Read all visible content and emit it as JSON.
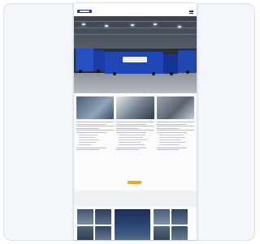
{
  "topbar": {
    "phone": "",
    "email": ""
  },
  "header": {
    "logo_text": ""
  },
  "hero": {
    "caption": ""
  },
  "columns": [
    {
      "heading": ""
    },
    {
      "heading": ""
    },
    {
      "heading": ""
    }
  ],
  "cta": {
    "label": ""
  },
  "section": {
    "title": ""
  },
  "colors": {
    "brand_blue": "#1d3c8f",
    "truck_blue": "#1f47b8",
    "cta_orange": "#f0a81c",
    "card_bg": "#f3f6fb"
  },
  "icons": [
    "menu-icon"
  ]
}
